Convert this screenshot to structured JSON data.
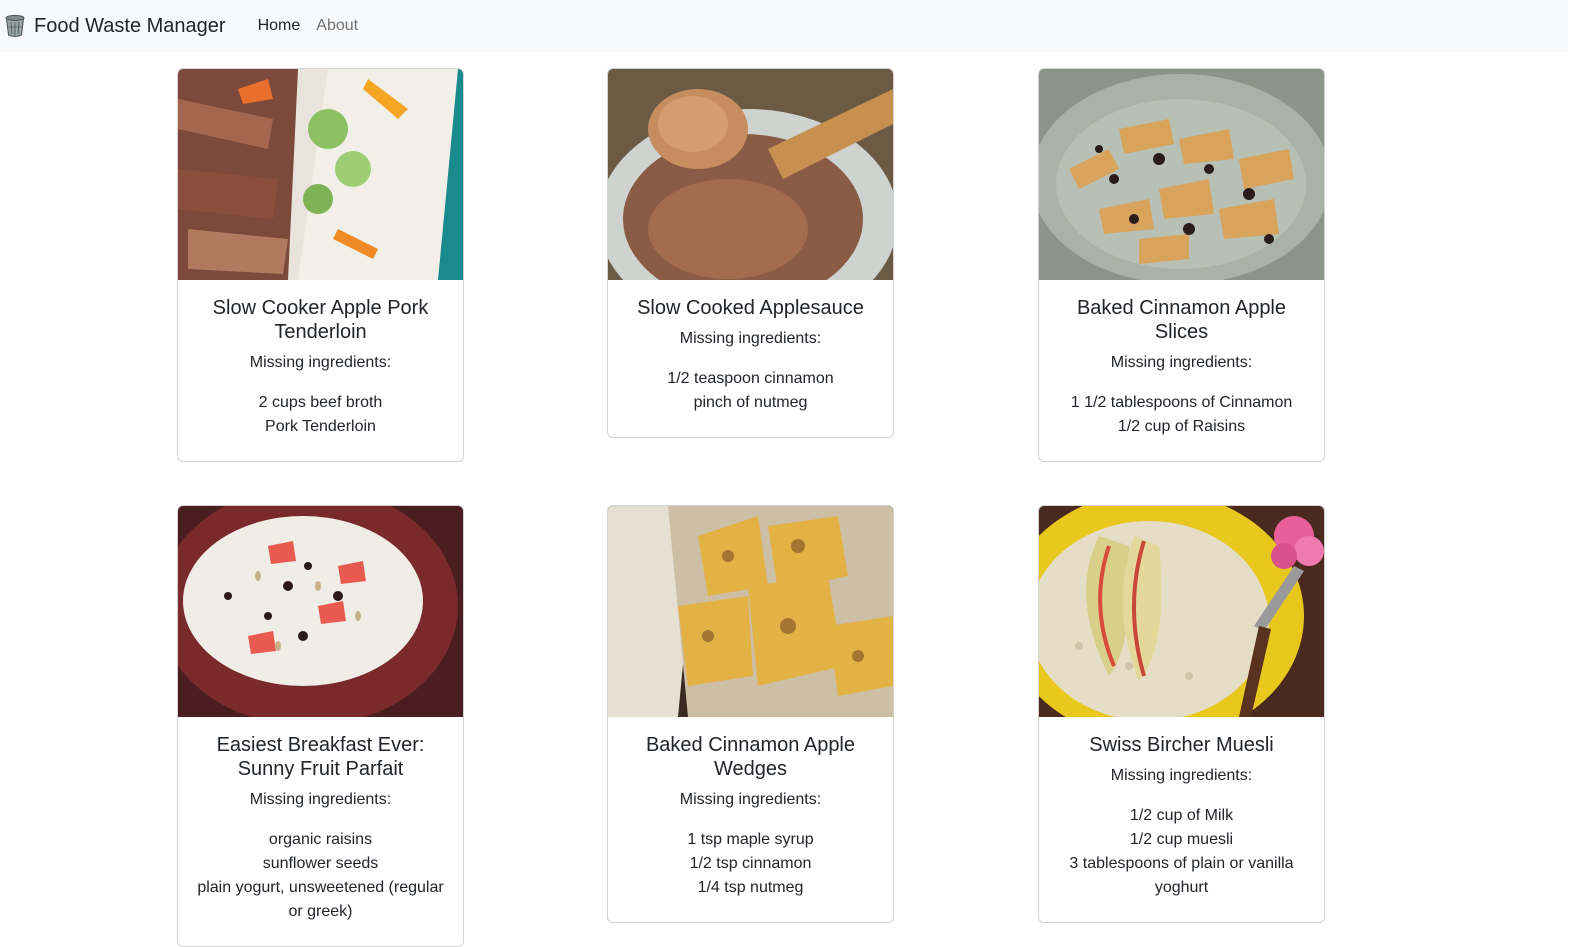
{
  "navbar": {
    "brand": "Food Waste Manager",
    "brand_icon": "trash-bin-icon",
    "links": [
      "Home",
      "About"
    ]
  },
  "missing_label": "Missing ingredients:",
  "recipes": [
    {
      "title": "Slow Cooker Apple Pork Tenderloin",
      "image": "pork-tenderloin-noodle-salad",
      "missing": [
        "2 cups beef broth",
        "Pork Tenderloin"
      ]
    },
    {
      "title": "Slow Cooked Applesauce",
      "image": "applesauce-bowl-wooden-spoon",
      "missing": [
        "1/2 teaspoon cinnamon",
        "pinch of nutmeg"
      ]
    },
    {
      "title": "Baked Cinnamon Apple Slices",
      "image": "cinnamon-apple-slices-raisins",
      "missing": [
        "1 1/2 tablespoons of Cinnamon",
        "1/2 cup of Raisins"
      ]
    },
    {
      "title": "Easiest Breakfast Ever: Sunny Fruit Parfait",
      "image": "fruit-parfait-bowl",
      "missing": [
        "organic raisins",
        "sunflower seeds",
        "plain yogurt, unsweetened (regular or greek)"
      ]
    },
    {
      "title": "Baked Cinnamon Apple Wedges",
      "image": "cinnamon-apple-wedges",
      "missing": [
        "1 tsp maple syrup",
        "1/2 tsp cinnamon",
        "1/4 tsp nutmeg"
      ]
    },
    {
      "title": "Swiss Bircher Muesli",
      "image": "bircher-muesli-yellow-bowl",
      "missing": [
        "1/2 cup of Milk",
        "1/2 cup muesli",
        "3 tablespoons of plain or vanilla yoghurt"
      ]
    }
  ]
}
